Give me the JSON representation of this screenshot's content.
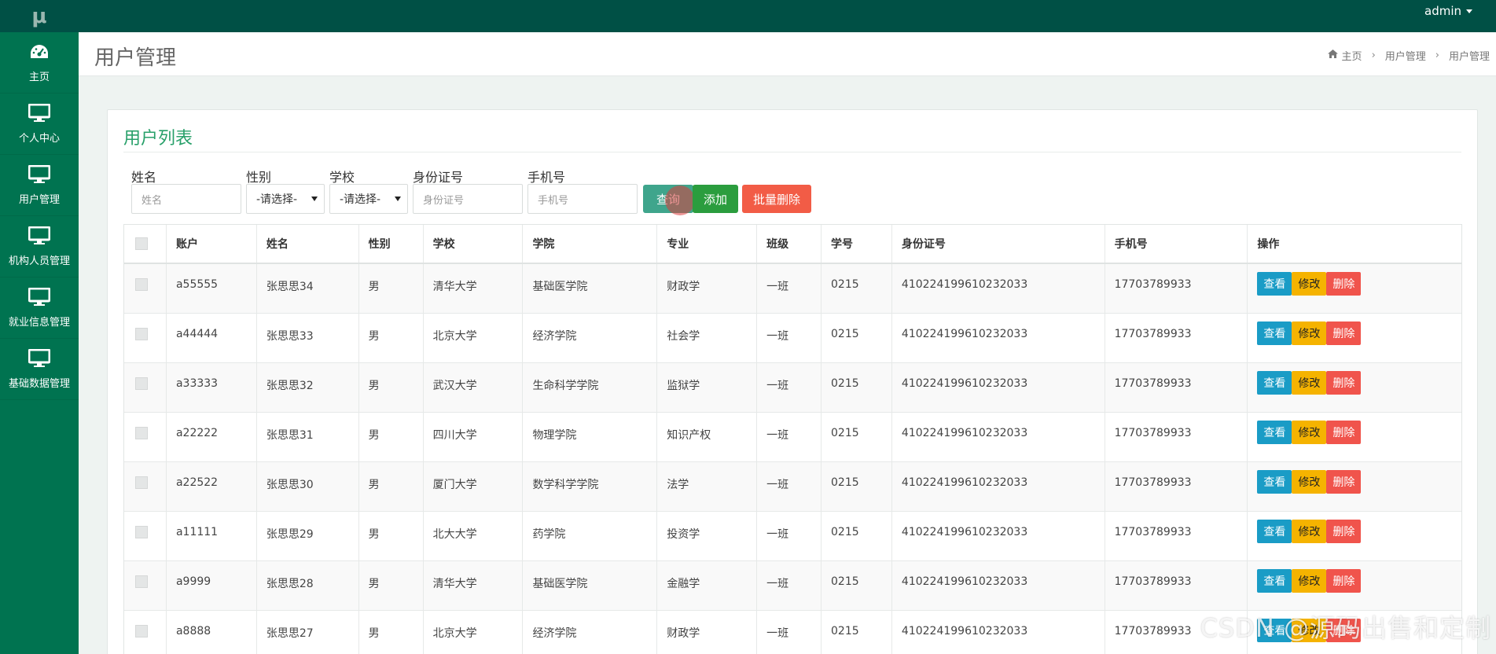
{
  "app": {
    "logo_text": "μ",
    "user_name": "admin"
  },
  "sidebar": {
    "items": [
      {
        "label": "主页",
        "icon": "dashboard-icon"
      },
      {
        "label": "个人中心",
        "icon": "monitor-icon"
      },
      {
        "label": "用户管理",
        "icon": "monitor-icon"
      },
      {
        "label": "机构人员管理",
        "icon": "monitor-icon"
      },
      {
        "label": "就业信息管理",
        "icon": "monitor-icon"
      },
      {
        "label": "基础数据管理",
        "icon": "monitor-icon"
      }
    ]
  },
  "header": {
    "title": "用户管理",
    "breadcrumb": [
      "主页",
      "用户管理",
      "用户管理"
    ]
  },
  "card": {
    "title": "用户列表"
  },
  "filters": {
    "name": {
      "label": "姓名",
      "placeholder": "姓名"
    },
    "gender": {
      "label": "性别",
      "value": "-请选择-"
    },
    "school": {
      "label": "学校",
      "value": "-请选择-"
    },
    "id_card": {
      "label": "身份证号",
      "placeholder": "身份证号"
    },
    "phone": {
      "label": "手机号",
      "placeholder": "手机号"
    }
  },
  "buttons": {
    "query": "查询",
    "add": "添加",
    "batch_delete": "批量删除"
  },
  "table": {
    "headers": [
      "账户",
      "姓名",
      "性别",
      "学校",
      "学院",
      "专业",
      "班级",
      "学号",
      "身份证号",
      "手机号",
      "操作"
    ],
    "op_labels": {
      "view": "查看",
      "edit": "修改",
      "delete": "删除"
    },
    "rows": [
      [
        "a55555",
        "张思思34",
        "男",
        "清华大学",
        "基础医学院",
        "财政学",
        "一班",
        "0215",
        "410224199610232033",
        "17703789933"
      ],
      [
        "a44444",
        "张思思33",
        "男",
        "北京大学",
        "经济学院",
        "社会学",
        "一班",
        "0215",
        "410224199610232033",
        "17703789933"
      ],
      [
        "a33333",
        "张思思32",
        "男",
        "武汉大学",
        "生命科学学院",
        "监狱学",
        "一班",
        "0215",
        "410224199610232033",
        "17703789933"
      ],
      [
        "a22222",
        "张思思31",
        "男",
        "四川大学",
        "物理学院",
        "知识产权",
        "一班",
        "0215",
        "410224199610232033",
        "17703789933"
      ],
      [
        "a22522",
        "张思思30",
        "男",
        "厦门大学",
        "数学科学学院",
        "法学",
        "一班",
        "0215",
        "410224199610232033",
        "17703789933"
      ],
      [
        "a11111",
        "张思思29",
        "男",
        "北大大学",
        "药学院",
        "投资学",
        "一班",
        "0215",
        "410224199610232033",
        "17703789933"
      ],
      [
        "a9999",
        "张思思28",
        "男",
        "清华大学",
        "基础医学院",
        "金融学",
        "一班",
        "0215",
        "410224199610232033",
        "17703789933"
      ],
      [
        "a8888",
        "张思思27",
        "男",
        "北京大学",
        "经济学院",
        "财政学",
        "一班",
        "0215",
        "410224199610232033",
        "17703789933"
      ]
    ]
  },
  "watermark": "CSDN @源码出售和定制",
  "colors": {
    "topbar": "#005045",
    "sidebar": "#007350",
    "accent": "#28a06a"
  }
}
